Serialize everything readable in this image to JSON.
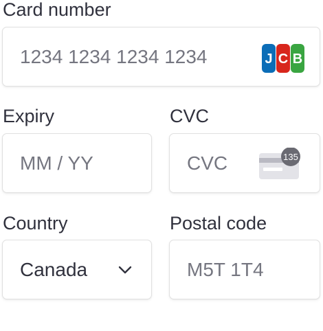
{
  "card_number": {
    "label": "Card number",
    "placeholder": "1234 1234 1234 1234",
    "brand_icon": "jcb-icon",
    "brand_letters": [
      "J",
      "C",
      "B"
    ],
    "brand_colors": [
      "#0b6db7",
      "#d8261c",
      "#3aa541"
    ]
  },
  "expiry": {
    "label": "Expiry",
    "placeholder": "MM / YY"
  },
  "cvc": {
    "label": "CVC",
    "placeholder": "CVC",
    "icon": "cvc-card-icon",
    "badge": "135"
  },
  "country": {
    "label": "Country",
    "value": "Canada",
    "icon": "chevron-down-icon"
  },
  "postal_code": {
    "label": "Postal code",
    "placeholder": "M5T 1T4"
  },
  "colors": {
    "text": "#30313d",
    "placeholder": "#757680",
    "border": "#e0e0e0"
  }
}
